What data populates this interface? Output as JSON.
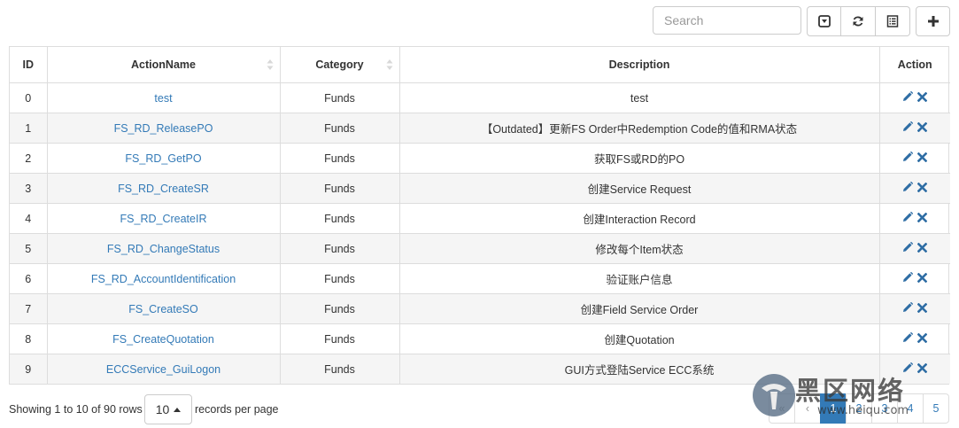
{
  "toolbar": {
    "search_placeholder": "Search",
    "buttons": [
      {
        "name": "toggle-icon"
      },
      {
        "name": "refresh-icon"
      },
      {
        "name": "columns-icon"
      },
      {
        "name": "plus-icon"
      }
    ]
  },
  "table": {
    "columns": [
      "ID",
      "ActionName",
      "Category",
      "Description",
      "Action"
    ],
    "rows": [
      {
        "id": "0",
        "name": "test",
        "category": "Funds",
        "description": "test"
      },
      {
        "id": "1",
        "name": "FS_RD_ReleasePO",
        "category": "Funds",
        "description": "【Outdated】更新FS Order中Redemption Code的值和RMA状态"
      },
      {
        "id": "2",
        "name": "FS_RD_GetPO",
        "category": "Funds",
        "description": "获取FS或RD的PO"
      },
      {
        "id": "3",
        "name": "FS_RD_CreateSR",
        "category": "Funds",
        "description": "创建Service Request"
      },
      {
        "id": "4",
        "name": "FS_RD_CreateIR",
        "category": "Funds",
        "description": "创建Interaction Record"
      },
      {
        "id": "5",
        "name": "FS_RD_ChangeStatus",
        "category": "Funds",
        "description": "修改每个Item状态"
      },
      {
        "id": "6",
        "name": "FS_RD_AccountIdentification",
        "category": "Funds",
        "description": "验证账户信息"
      },
      {
        "id": "7",
        "name": "FS_CreateSO",
        "category": "Funds",
        "description": "创建Field Service Order"
      },
      {
        "id": "8",
        "name": "FS_CreateQuotation",
        "category": "Funds",
        "description": "创建Quotation"
      },
      {
        "id": "9",
        "name": "ECCService_GuiLogon",
        "category": "Funds",
        "description": "GUI方式登陆Service ECC系统"
      }
    ]
  },
  "footer": {
    "showing": "Showing 1 to 10 of 90 rows",
    "page_size": "10",
    "per_page_label": "records per page",
    "pager": [
      "«",
      "‹",
      "1",
      "2",
      "3",
      "4",
      "5"
    ]
  },
  "watermark": {
    "text": "黑区网络",
    "url": "www.heiqu.com"
  },
  "colors": {
    "link": "#337ab7",
    "active_page": "#337ab7",
    "row_stripe": "#f5f5f5",
    "border": "#dddddd"
  }
}
